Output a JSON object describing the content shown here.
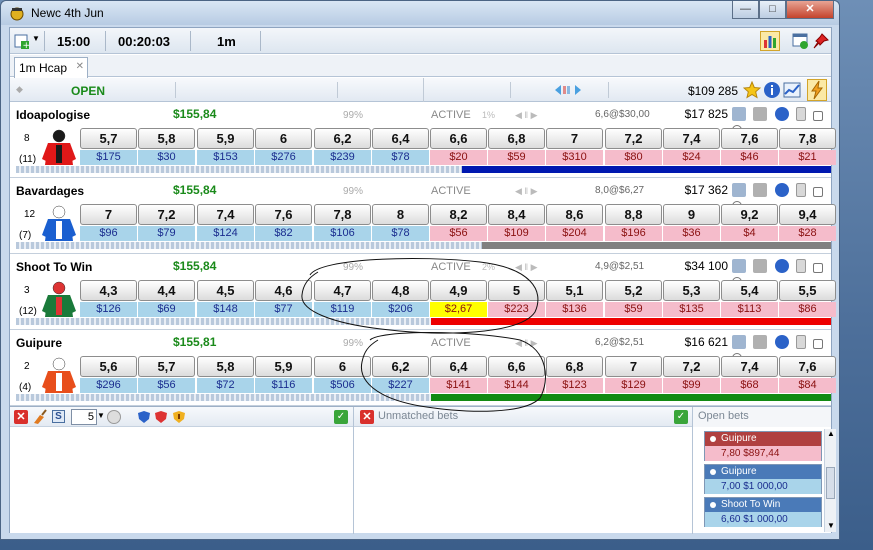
{
  "window": {
    "title": "Newc 4th Jun"
  },
  "toolbar": {
    "time": "15:00",
    "countdown": "00:20:03",
    "interval": "1m"
  },
  "tab": {
    "label": "1m Hcap"
  },
  "header": {
    "status": "OPEN",
    "total_matched": "$109 285"
  },
  "runners": [
    {
      "name": "Idoapologise",
      "pl": "$155,84",
      "pct": "99%",
      "status": "ACTIVE",
      "pct2": "1%",
      "last": "6,6@$30,00",
      "matched": "$17 825",
      "number": "8",
      "draw": "(11)",
      "prices": [
        "5,7",
        "5,8",
        "5,9",
        "6",
        "6,2",
        "6,4",
        "6,6",
        "6,8",
        "7",
        "7,2",
        "7,4",
        "7,6",
        "7,8"
      ],
      "amounts": [
        "$175",
        "$30",
        "$153",
        "$276",
        "$239",
        "$78",
        "$20",
        "$59",
        "$310",
        "$80",
        "$24",
        "$46",
        "$21"
      ],
      "wom_color": "#0018b0"
    },
    {
      "name": "Bavardages",
      "pl": "$155,84",
      "pct": "99%",
      "status": "ACTIVE",
      "pct2": "",
      "last": "8,0@$6,27",
      "matched": "$17 362",
      "number": "12",
      "draw": "(7)",
      "prices": [
        "7",
        "7,2",
        "7,4",
        "7,6",
        "7,8",
        "8",
        "8,2",
        "8,4",
        "8,6",
        "8,8",
        "9",
        "9,2",
        "9,4"
      ],
      "amounts": [
        "$96",
        "$79",
        "$124",
        "$82",
        "$106",
        "$78",
        "$56",
        "$109",
        "$204",
        "$196",
        "$36",
        "$4",
        "$28"
      ],
      "wom_color": "#808080"
    },
    {
      "name": "Shoot To Win",
      "pl": "$155,84",
      "pct": "99%",
      "status": "ACTIVE",
      "pct2": "2%",
      "last": "4,9@$2,51",
      "matched": "$34 100",
      "number": "3",
      "draw": "(12)",
      "prices": [
        "4,3",
        "4,4",
        "4,5",
        "4,6",
        "4,7",
        "4,8",
        "4,9",
        "5",
        "5,1",
        "5,2",
        "5,3",
        "5,4",
        "5,5"
      ],
      "amounts": [
        "$126",
        "$69",
        "$148",
        "$77",
        "$119",
        "$206",
        "$2,67",
        "$223",
        "$136",
        "$59",
        "$135",
        "$113",
        "$86"
      ],
      "wom_color": "#ee0000"
    },
    {
      "name": "Guipure",
      "pl": "$155,81",
      "pct": "99%",
      "status": "ACTIVE",
      "pct2": "",
      "last": "6,2@$2,51",
      "matched": "$16 621",
      "number": "2",
      "draw": "(4)",
      "prices": [
        "5,6",
        "5,7",
        "5,8",
        "5,9",
        "6",
        "6,2",
        "6,4",
        "6,6",
        "6,8",
        "7",
        "7,2",
        "7,4",
        "7,6"
      ],
      "amounts": [
        "$296",
        "$56",
        "$72",
        "$116",
        "$506",
        "$227",
        "$141",
        "$144",
        "$123",
        "$129",
        "$99",
        "$68",
        "$84"
      ],
      "wom_color": "#128a12"
    }
  ],
  "bottom": {
    "stake": "5",
    "unmatched_title": "Unmatched bets",
    "open_title": "Open bets",
    "open_bets": [
      {
        "name": "Guipure",
        "detail": "7,80   $897,44",
        "type": "lay"
      },
      {
        "name": "Guipure",
        "detail": "7,00   $1 000,00",
        "type": "back"
      },
      {
        "name": "Shoot To Win",
        "detail": "6,60   $1 000,00",
        "type": "back"
      }
    ]
  },
  "colors": {
    "back": "#a9d4ea",
    "lay": "#f5bccb",
    "highlight": "#ffff00",
    "green_text": "#1a8a1a"
  }
}
